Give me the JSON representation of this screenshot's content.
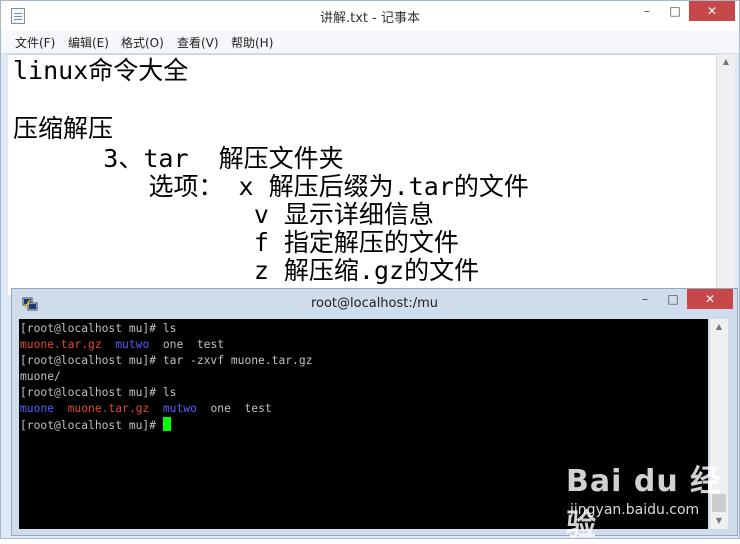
{
  "notepad": {
    "title": "讲解.txt - 记事本",
    "window_buttons": {
      "minimize": "–",
      "maximize": "□",
      "close": "✕"
    },
    "menus": [
      "文件(F)",
      "编辑(E)",
      "格式(O)",
      "查看(V)",
      "帮助(H)"
    ],
    "lines": [
      "linux命令大全",
      "压缩解压",
      "      3、tar  解压文件夹",
      "         选项： x 解压后缀为.tar的文件",
      "                v 显示详细信息",
      "                f 指定解压的文件",
      "                z 解压缩.gz的文件"
    ]
  },
  "terminal": {
    "title": "root@localhost:/mu",
    "window_buttons": {
      "minimize": "–",
      "maximize": "□",
      "close": "✕"
    },
    "lines": [
      [
        {
          "t": "[root@localhost mu]# ls",
          "c": "#c0c0c0"
        }
      ],
      [
        {
          "t": "muone.tar.gz",
          "c": "#e0453a"
        },
        {
          "t": "  ",
          "c": "#c0c0c0"
        },
        {
          "t": "mutwo",
          "c": "#5a5aff"
        },
        {
          "t": "  one  test",
          "c": "#c0c0c0"
        }
      ],
      [
        {
          "t": "[root@localhost mu]# tar -zxvf muone.tar.gz",
          "c": "#c0c0c0"
        }
      ],
      [
        {
          "t": "muone/",
          "c": "#c0c0c0"
        }
      ],
      [
        {
          "t": "[root@localhost mu]# ls",
          "c": "#c0c0c0"
        }
      ],
      [
        {
          "t": "muone",
          "c": "#5a5aff"
        },
        {
          "t": "  ",
          "c": "#c0c0c0"
        },
        {
          "t": "muone.tar.gz",
          "c": "#e0453a"
        },
        {
          "t": "  ",
          "c": "#c0c0c0"
        },
        {
          "t": "mutwo",
          "c": "#5a5aff"
        },
        {
          "t": "  one  test",
          "c": "#c0c0c0"
        }
      ],
      [
        {
          "t": "[root@localhost mu]# ",
          "c": "#c0c0c0"
        }
      ]
    ],
    "cursor_color": "#00ff00"
  },
  "watermark": {
    "brand": "Bai du 经验",
    "url": "jingyan.baidu.com"
  }
}
